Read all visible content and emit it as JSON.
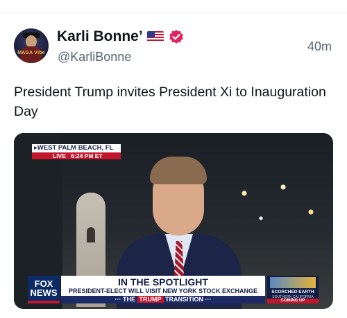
{
  "post": {
    "display_name": "Karli Bonne’",
    "handle": "@KarliBonne",
    "timestamp": "40m",
    "text": "President Trump invites President Xi to Inauguration Day",
    "avatar_text": "MAGA Vibe",
    "icons": [
      "us-flag-icon",
      "verified-badge-icon"
    ],
    "colors": {
      "verified": "#e0245e",
      "secondary_text": "#536471"
    }
  },
  "media": {
    "location": "▸WEST PALM BEACH, FL",
    "live_label": "LIVE",
    "live_time": "6:24 PM ET",
    "network_logo": [
      "FOX",
      "NEWS"
    ],
    "headline": "IN THE SPOTLIGHT",
    "subheadline": "PRESIDENT-ELECT WILL VISIT NEW YORK STOCK EXCHANGE",
    "ticker_prefix": "··· THE",
    "ticker_highlight": "TRUMP",
    "ticker_suffix": "TRANSITION ···",
    "side_title": "SCORCHED EARTH",
    "side_sub": "SOUTHERN CALIFORNIA WILDFIRE",
    "side_cta": "COMING UP"
  }
}
